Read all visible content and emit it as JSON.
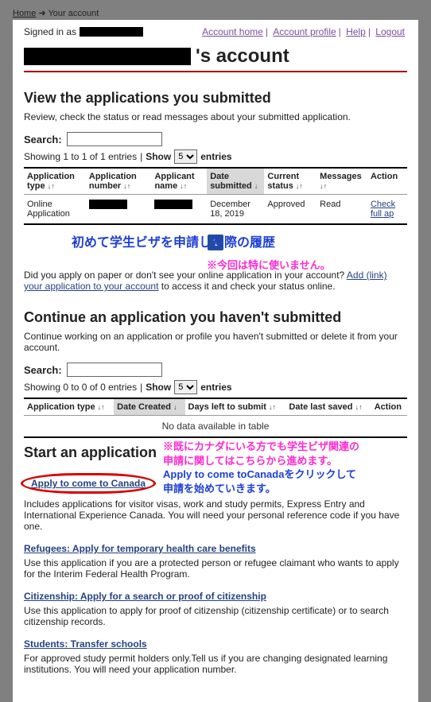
{
  "breadcrumb": {
    "home": "Home",
    "arrow": "➜",
    "current": "Your account"
  },
  "topbar": {
    "signed": "Signed in as",
    "account_home": "Account home",
    "account_profile": "Account profile",
    "help": "Help",
    "logout": "Logout"
  },
  "h1_suffix": "'s account",
  "submitted": {
    "heading": "View the applications you submitted",
    "desc": "Review, check the status or read messages about your submitted application.",
    "search_label": "Search:",
    "showing_pre": "Showing 1 to 1 of 1 entries",
    "show_label": "Show",
    "show_value": "5",
    "entries_label": "entries",
    "cols": {
      "app_type": "Application type",
      "app_number": "Application number",
      "app_name": "Applicant name",
      "date_submitted": "Date submitted",
      "current_status": "Current status",
      "messages": "Messages",
      "action": "Action"
    },
    "row": {
      "type": "Online Application",
      "date": "December 18, 2019",
      "status": "Approved",
      "messages": "Read",
      "action": "Check full ap"
    },
    "page": "1",
    "para_pre": "Did you apply on paper or don't see your online application in your account? ",
    "para_link": "Add (link) your application to your account",
    "para_post": " to access it and check your status online."
  },
  "annotations": {
    "blue1": "初めて学生ビザを申請した際の履歴",
    "pink1": "※今回は特に使いません。",
    "pink2a": "※既にカナダにいる方でも学生ビザ関連の",
    "pink2b": "申請に関してはこちらから進めます。",
    "blue2a": "Apply to come toCanadaをクリックして",
    "blue2b": "申請を始めていきます。"
  },
  "continue": {
    "heading": "Continue an application you haven't submitted",
    "desc": "Continue working on an application or profile you haven't submitted or delete it from your account.",
    "search_label": "Search:",
    "showing_pre": "Showing 0 to 0 of 0 entries",
    "show_label": "Show",
    "show_value": "5",
    "entries_label": "entries",
    "cols": {
      "app_type": "Application type",
      "date_created": "Date Created",
      "days_left": "Days left to submit",
      "date_saved": "Date last saved",
      "action": "Action"
    },
    "no_data": "No data available in table"
  },
  "start": {
    "heading": "Start an application",
    "links": {
      "apply": "Apply to come to Canada",
      "apply_desc": "Includes applications for visitor visas, work and study permits, Express Entry and International Experience Canada. You will need your personal reference code if you have one.",
      "refugees": "Refugees: Apply for temporary health care benefits",
      "refugees_desc": "Use this application if you are a protected person or refugee claimant who wants to apply for the Interim Federal Health Program.",
      "citizenship": "Citizenship: Apply for a search or proof of citizenship ",
      "citizenship_desc": "Use this application to apply for proof of citizenship (citizenship certificate) or to search citizenship records.",
      "students": "Students: Transfer schools",
      "students_desc": "For approved study permit holders only.Tell us if you are changing designated learning institutions. You will need your application number."
    }
  }
}
